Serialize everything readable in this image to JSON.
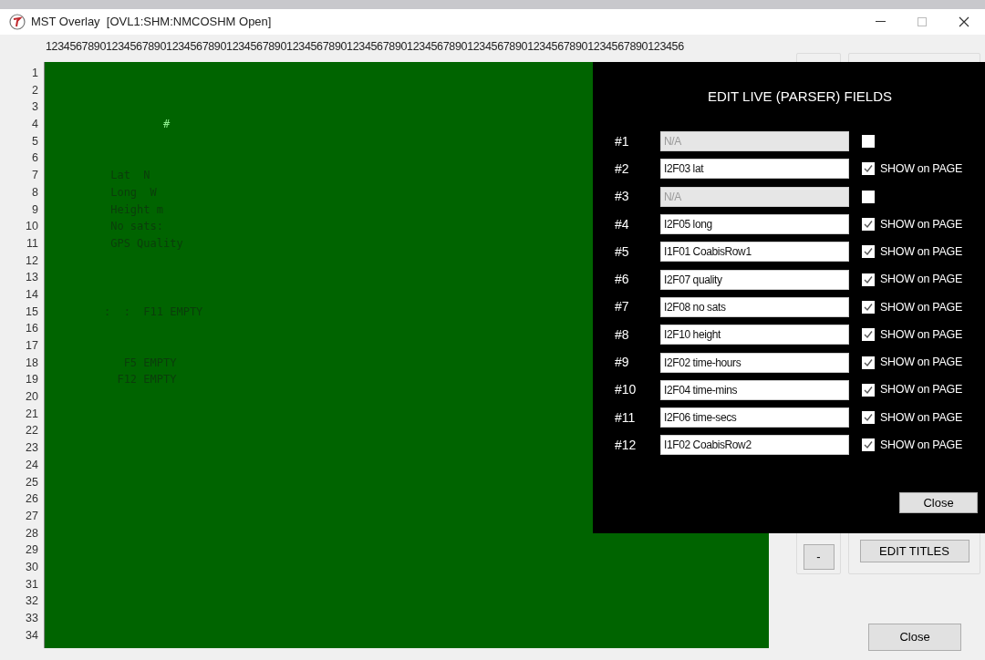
{
  "window": {
    "title": "MST Overlay  [OVL1:SHM:NMCOSHM Open]"
  },
  "ruler": "1234567890123456789012345678901234567890123456789012345678901234567890123456789012345678901234567890123456",
  "display": {
    "rows": [
      {
        "number": "1"
      },
      {
        "number": "2"
      },
      {
        "number": "3"
      },
      {
        "number": "4",
        "text": "#",
        "color": "#8ef08e"
      },
      {
        "number": "5"
      },
      {
        "number": "6"
      },
      {
        "number": "7",
        "text": "Lat  N",
        "color": "#0b3d0b"
      },
      {
        "number": "8",
        "text": "Long  W",
        "color": "#0b3d0b"
      },
      {
        "number": "9",
        "text": "Height m",
        "color": "#0b3d0b"
      },
      {
        "number": "10",
        "text": "No sats:",
        "color": "#0b3d0b"
      },
      {
        "number": "11",
        "text": "GPS Quality",
        "color": "#0b3d0b"
      },
      {
        "number": "12"
      },
      {
        "number": "13"
      },
      {
        "number": "14"
      },
      {
        "number": "15",
        "text": ":  :  F11 EMPTY",
        "color": "#0b3d0b"
      },
      {
        "number": "16"
      },
      {
        "number": "17"
      },
      {
        "number": "18",
        "text": "F5 EMPTY",
        "color": "#0b3d0b"
      },
      {
        "number": "19",
        "text": "F12 EMPTY",
        "color": "#0b3d0b"
      },
      {
        "number": "20"
      },
      {
        "number": "21"
      },
      {
        "number": "22"
      },
      {
        "number": "23"
      },
      {
        "number": "24"
      },
      {
        "number": "25"
      },
      {
        "number": "26"
      },
      {
        "number": "27"
      },
      {
        "number": "28"
      },
      {
        "number": "29"
      },
      {
        "number": "30"
      },
      {
        "number": "31"
      },
      {
        "number": "32"
      },
      {
        "number": "33"
      },
      {
        "number": "34"
      }
    ]
  },
  "dialog": {
    "title": "EDIT LIVE (PARSER) FIELDS",
    "fields": [
      {
        "number": "#1",
        "value": "N/A",
        "disabled": true,
        "checked": false
      },
      {
        "number": "#2",
        "value": "I2F03 lat",
        "disabled": false,
        "checked": true,
        "label": "SHOW on PAGE"
      },
      {
        "number": "#3",
        "value": "N/A",
        "disabled": true,
        "checked": false
      },
      {
        "number": "#4",
        "value": "I2F05 long",
        "disabled": false,
        "checked": true,
        "label": "SHOW on PAGE"
      },
      {
        "number": "#5",
        "value": "I1F01 CoabisRow1",
        "disabled": false,
        "checked": true,
        "label": "SHOW on PAGE"
      },
      {
        "number": "#6",
        "value": "I2F07 quality",
        "disabled": false,
        "checked": true,
        "label": "SHOW on PAGE"
      },
      {
        "number": "#7",
        "value": "I2F08 no sats",
        "disabled": false,
        "checked": true,
        "label": "SHOW on PAGE"
      },
      {
        "number": "#8",
        "value": "I2F10 height",
        "disabled": false,
        "checked": true,
        "label": "SHOW on PAGE"
      },
      {
        "number": "#9",
        "value": "I2F02 time-hours",
        "disabled": false,
        "checked": true,
        "label": "SHOW on PAGE"
      },
      {
        "number": "#10",
        "value": "I2F04 time-mins",
        "disabled": false,
        "checked": true,
        "label": "SHOW on PAGE"
      },
      {
        "number": "#11",
        "value": "I2F06 time-secs",
        "disabled": false,
        "checked": true,
        "label": "SHOW on PAGE"
      },
      {
        "number": "#12",
        "value": "I1F02 CoabisRow2",
        "disabled": false,
        "checked": true,
        "label": "SHOW on PAGE"
      }
    ],
    "close_button": "Close"
  },
  "side_panel": {
    "minus_button": "-",
    "edit_titles_button": "EDIT TITLES",
    "close_button": "Close"
  }
}
